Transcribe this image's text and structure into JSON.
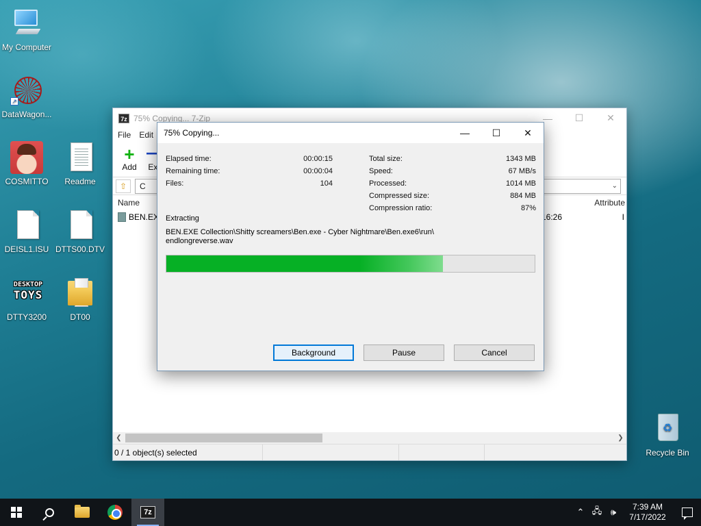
{
  "desktop": {
    "icons": [
      {
        "label": "My Computer"
      },
      {
        "label": "DataWagon..."
      },
      {
        "label": "COSMITTO"
      },
      {
        "label": "Readme"
      },
      {
        "label": "DEISL1.ISU"
      },
      {
        "label": "DTTS00.DTV"
      },
      {
        "label": "DTTY3200"
      },
      {
        "label": "DT00"
      },
      {
        "label": "Recycle Bin"
      }
    ],
    "toys_logo_line1": "DESKTOP",
    "toys_logo_line2": "TOYS"
  },
  "main_window": {
    "title": "75% Copying... 7-Zip",
    "app_badge": "7z",
    "menu": [
      "File",
      "Edit"
    ],
    "toolbar": {
      "add_label": "Add",
      "extract_label": "Extr"
    },
    "address": "C",
    "columns": {
      "name": "Name",
      "attributes": "Attribute"
    },
    "files": [
      {
        "name": "BEN.EXE",
        "time": "16:26",
        "attr": "I"
      }
    ],
    "status": "0 / 1 object(s) selected"
  },
  "dialog": {
    "title": "75% Copying...",
    "left_stats": [
      {
        "label": "Elapsed time:",
        "value": "00:00:15"
      },
      {
        "label": "Remaining time:",
        "value": "00:00:04"
      },
      {
        "label": "Files:",
        "value": "104"
      }
    ],
    "right_stats": [
      {
        "label": "Total size:",
        "value": "1343 MB"
      },
      {
        "label": "Speed:",
        "value": "67 MB/s"
      },
      {
        "label": "Processed:",
        "value": "1014 MB"
      },
      {
        "label": "Compressed size:",
        "value": "884 MB"
      },
      {
        "label": "Compression ratio:",
        "value": "87%"
      }
    ],
    "action_label": "Extracting",
    "current_path_line1": "BEN.EXE Collection\\Shitty screamers\\Ben.exe - Cyber Nightmare\\Ben.exe6\\run\\",
    "current_path_line2": "endlongreverse.wav",
    "progress_percent": 75,
    "buttons": {
      "background": "Background",
      "pause": "Pause",
      "cancel": "Cancel"
    }
  },
  "taskbar": {
    "clock_time": "7:39 AM",
    "clock_date": "7/17/2022",
    "sevenzip_label": "7z"
  },
  "colors": {
    "progress_fill": "#06b025",
    "taskbar_bg": "#101418",
    "accent": "#0078d7"
  }
}
